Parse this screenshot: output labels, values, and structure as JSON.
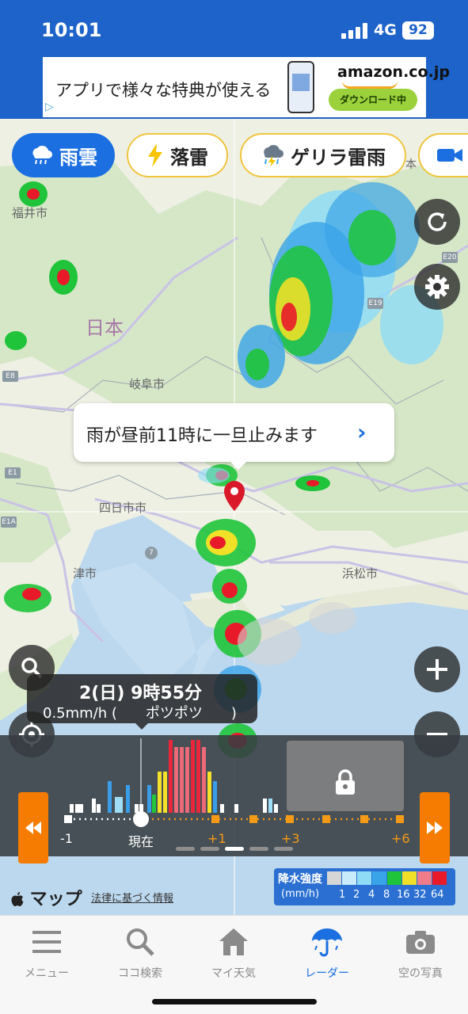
{
  "status": {
    "time": "10:01",
    "network": "4G",
    "battery": "92"
  },
  "ad": {
    "text": "アプリで様々な特典が使える",
    "brand": "amazon.co.jp",
    "cta": "ダウンロード中"
  },
  "chips": [
    {
      "label": "雨雲",
      "icon": "rain-cloud-icon"
    },
    {
      "label": "落雷",
      "icon": "lightning-icon"
    },
    {
      "label": "ゲリラ雷雨",
      "icon": "thunder-cloud-icon"
    },
    {
      "label": "",
      "icon": "video-camera-icon"
    }
  ],
  "map": {
    "labels": {
      "fukui": "福井市",
      "japan": "日本",
      "gifu": "岐阜市",
      "yokkaichi": "四日市市",
      "tsu": "津市",
      "hamamatsu": "浜松市",
      "partial": "本"
    },
    "routes": [
      "E20",
      "E19",
      "E8",
      "E1",
      "E1A",
      "7"
    ]
  },
  "tooltip": {
    "text": "雨が昼前11時に一旦止みます",
    "chevron": "›"
  },
  "time_box": {
    "main": "2(日) 9時55分",
    "sub": "0.5mm/h (　　ポツポツ　　)"
  },
  "timeline": {
    "labels": {
      "minus1": "-1",
      "now": "現在",
      "plus1": "+1",
      "plus3": "+3",
      "plus6": "+6"
    },
    "bars": [
      {
        "h": 0.12,
        "c": "#ffffff"
      },
      {
        "h": 0.12,
        "c": "#ffffff"
      },
      {
        "h": 0.12,
        "c": "#ffffff"
      },
      {
        "h": 0.2,
        "c": "#ffffff"
      },
      {
        "h": 0.12,
        "c": "#ffffff"
      },
      {
        "h": 0.44,
        "c": "#3a9de8"
      },
      {
        "h": 0.22,
        "c": "#9fdcf5"
      },
      {
        "h": 0.22,
        "c": "#9fdcf5"
      },
      {
        "h": 0.38,
        "c": "#3a9de8"
      },
      {
        "h": 0.12,
        "c": "#ffffff"
      },
      {
        "h": 0.12,
        "c": "#ffffff"
      },
      {
        "h": 0.38,
        "c": "#3a9de8"
      },
      {
        "h": 0.25,
        "c": "#22c63a"
      },
      {
        "h": 0.57,
        "c": "#f5e12a"
      },
      {
        "h": 0.57,
        "c": "#f5e12a"
      },
      {
        "h": 1.0,
        "c": "#e8283a"
      },
      {
        "h": 0.9,
        "c": "#ec6a78"
      },
      {
        "h": 0.9,
        "c": "#ec6a78"
      },
      {
        "h": 0.9,
        "c": "#ec6a78"
      },
      {
        "h": 1.0,
        "c": "#e8283a"
      },
      {
        "h": 1.0,
        "c": "#e8283a"
      },
      {
        "h": 0.9,
        "c": "#ec6a78"
      },
      {
        "h": 0.57,
        "c": "#f5e12a"
      },
      {
        "h": 0.44,
        "c": "#3a9de8"
      },
      {
        "h": 0.12,
        "c": "#ffffff"
      },
      {
        "h": 0.12,
        "c": "#ffffff"
      },
      {
        "h": 0.2,
        "c": "#ffffff"
      },
      {
        "h": 0.2,
        "c": "#9fdcf5"
      },
      {
        "h": 0.12,
        "c": "#ffffff"
      }
    ]
  },
  "legend": {
    "title": "降水強度",
    "unit": "(mm/h)",
    "values": [
      "1",
      "2",
      "4",
      "8",
      "16",
      "32",
      "64"
    ],
    "colors": [
      "#d6d6d6",
      "#c8ecfa",
      "#8fdcf6",
      "#3aa4e8",
      "#1fc43a",
      "#f0e028",
      "#f07c8a",
      "#e81a2a"
    ]
  },
  "attribution": {
    "maps": "マップ",
    "legal": "法律に基づく情報"
  },
  "tabs": [
    {
      "label": "メニュー",
      "icon": "menu-icon"
    },
    {
      "label": "ココ検索",
      "icon": "search-icon"
    },
    {
      "label": "マイ天気",
      "icon": "home-icon"
    },
    {
      "label": "レーダー",
      "icon": "umbrella-icon"
    },
    {
      "label": "空の写真",
      "icon": "camera-icon"
    }
  ],
  "colors": {
    "accent": "#1b6fe0",
    "orange": "#f57c00",
    "status_bar": "#1d63c9"
  }
}
